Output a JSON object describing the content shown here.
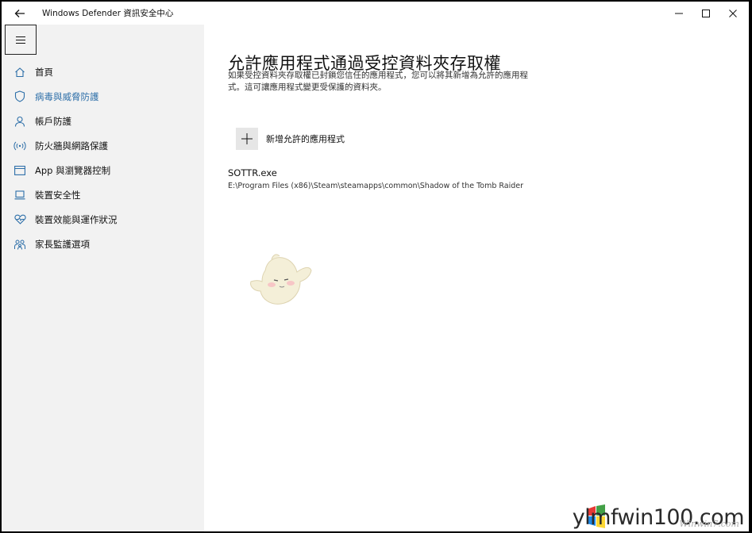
{
  "titlebar": {
    "app_title": "Windows Defender 資訊安全中心"
  },
  "sidebar": {
    "items": [
      {
        "label": "首頁",
        "icon": "home-icon",
        "active": false
      },
      {
        "label": "病毒與威脅防護",
        "icon": "shield-icon",
        "active": true
      },
      {
        "label": "帳戶防護",
        "icon": "person-icon",
        "active": false
      },
      {
        "label": "防火牆與網路保護",
        "icon": "wireless-icon",
        "active": false
      },
      {
        "label": "App 與瀏覽器控制",
        "icon": "app-window-icon",
        "active": false
      },
      {
        "label": "裝置安全性",
        "icon": "laptop-icon",
        "active": false
      },
      {
        "label": "裝置效能與運作狀況",
        "icon": "heart-icon",
        "active": false
      },
      {
        "label": "家長監護選項",
        "icon": "family-icon",
        "active": false
      }
    ]
  },
  "main": {
    "title": "允許應用程式通過受控資料夾存取權",
    "description": "如果受控資料夾存取權已封鎖您信任的應用程式，您可以將其新增為允許的應用程式。這可讓應用程式變更受保護的資料夾。",
    "add_label": "新增允許的應用程式",
    "apps": [
      {
        "name": "SOTTR.exe",
        "path": "E:\\Program Files (x86)\\Steam\\steamapps\\common\\Shadow of the Tomb Raider"
      }
    ]
  },
  "watermark": {
    "site": "ylmfwin100.com",
    "sub": "Winwin7.com"
  },
  "colors": {
    "accent": "#2c6ea8",
    "sidebar_bg": "#f2f2f2"
  }
}
